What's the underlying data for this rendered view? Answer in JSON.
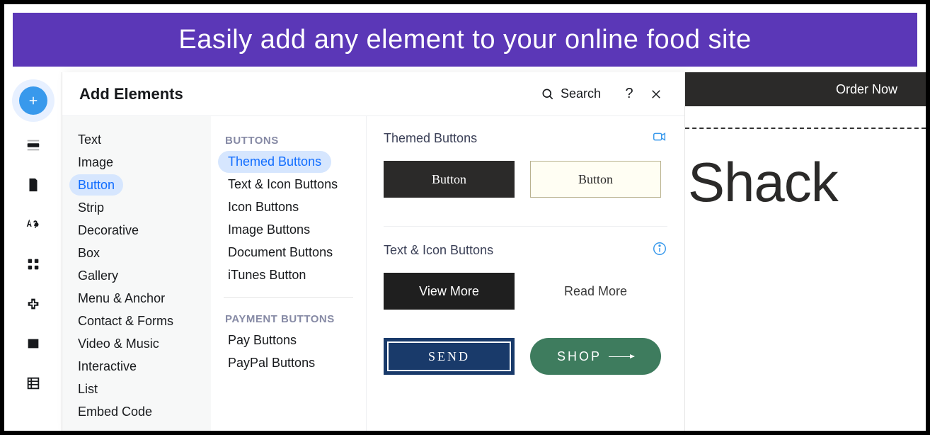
{
  "banner": "Easily add any element to your online food site",
  "panel": {
    "title": "Add Elements",
    "search": "Search"
  },
  "categories": [
    "Text",
    "Image",
    "Button",
    "Strip",
    "Decorative",
    "Box",
    "Gallery",
    "Menu & Anchor",
    "Contact & Forms",
    "Video & Music",
    "Interactive",
    "List",
    "Embed Code"
  ],
  "activeCategory": "Button",
  "subGroups": [
    {
      "label": "BUTTONS",
      "items": [
        "Themed Buttons",
        "Text & Icon Buttons",
        "Icon Buttons",
        "Image Buttons",
        "Document Buttons",
        "iTunes Button"
      ],
      "active": "Themed Buttons"
    },
    {
      "label": "PAYMENT BUTTONS",
      "items": [
        "Pay Buttons",
        "PayPal Buttons"
      ]
    }
  ],
  "sections": {
    "themed": {
      "title": "Themed Buttons",
      "btn1": "Button",
      "btn2": "Button"
    },
    "texticon": {
      "title": "Text & Icon Buttons",
      "viewMore": "View More",
      "readMore": "Read More",
      "send": "SEND",
      "shop": "SHOP"
    }
  },
  "preview": {
    "cta": "Order Now",
    "brand": "Shack"
  }
}
